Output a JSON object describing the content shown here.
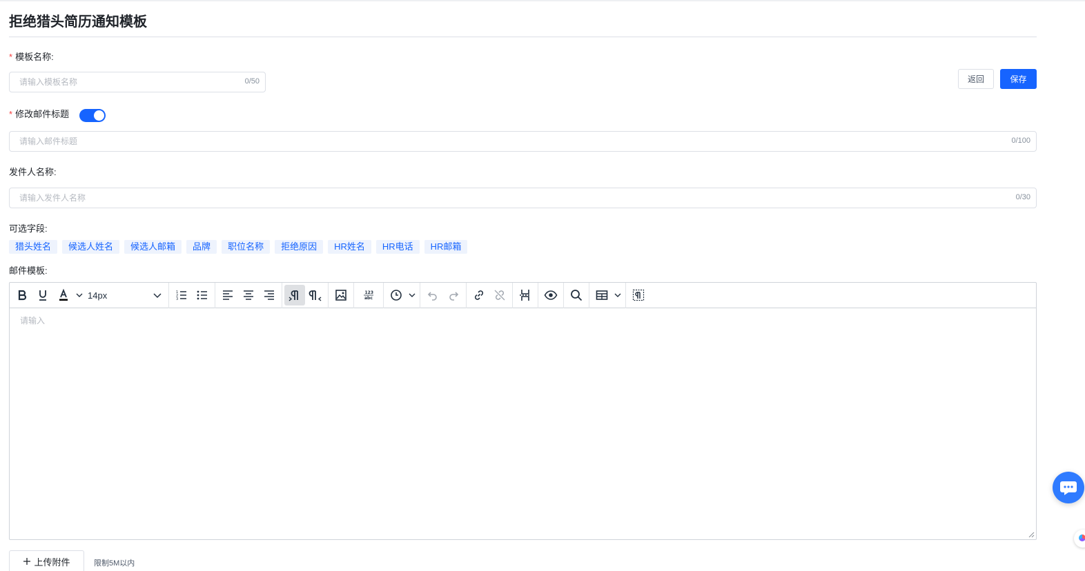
{
  "page": {
    "title": "拒绝猎头简历通知模板"
  },
  "colors": {
    "primary": "#1664ff",
    "required": "#f53f3f",
    "tag_bg": "#eef3fd"
  },
  "template_name": {
    "label": "模板名称:",
    "placeholder": "请输入模板名称",
    "counter": "0/50"
  },
  "actions": {
    "back_label": "返回",
    "save_label": "保存"
  },
  "mail_subject": {
    "label": "修改邮件标题",
    "toggle_on": true,
    "placeholder": "请输入邮件标题",
    "counter": "0/100"
  },
  "sender_name": {
    "label": "发件人名称:",
    "placeholder": "请输入发件人名称",
    "counter": "0/30"
  },
  "optional_fields": {
    "label": "可选字段:",
    "tags": [
      "猎头姓名",
      "候选人姓名",
      "候选人邮箱",
      "品牌",
      "职位名称",
      "拒绝原因",
      "HR姓名",
      "HR电话",
      "HR邮箱"
    ]
  },
  "mail_template": {
    "label": "邮件模板:",
    "font_size": "14px",
    "placeholder": "请输入",
    "toolbar_icons": [
      "bold-icon",
      "underline-icon",
      "text-color-icon",
      "font-size-select",
      "ordered-list-icon",
      "bullet-list-icon",
      "align-left-icon",
      "align-center-icon",
      "align-right-icon",
      "ltr-icon",
      "rtl-icon",
      "image-icon",
      "word-count-icon",
      "clock-icon",
      "undo-icon",
      "redo-icon",
      "link-icon",
      "unlink-icon",
      "page-break-icon",
      "preview-icon",
      "search-icon",
      "table-icon",
      "show-blocks-icon"
    ]
  },
  "attachment": {
    "upload_label": "上传附件",
    "hint": "限制5M以内"
  }
}
